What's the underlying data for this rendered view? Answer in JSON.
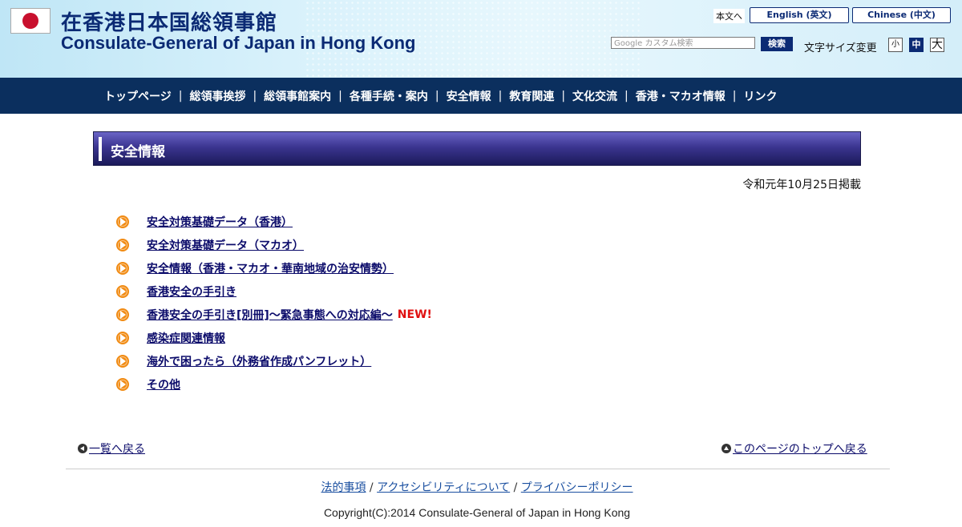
{
  "header": {
    "title_ja": "在香港日本国総領事館",
    "title_en": "Consulate-General of Japan in Hong Kong",
    "honbun": "本文へ",
    "lang_en": "English (英文)",
    "lang_zh": "Chinese (中文)",
    "search_placeholder": "Google カスタム検索",
    "search_button": "検索",
    "fontsize_label": "文字サイズ変更",
    "fontsize_small": "小",
    "fontsize_medium": "中",
    "fontsize_large": "大"
  },
  "nav": {
    "items": [
      "トップページ",
      "総領事挨拶",
      "総領事館案内",
      "各種手続・案内",
      "安全情報",
      "教育関連",
      "文化交流",
      "香港・マカオ情報",
      "リンク"
    ],
    "separator": "|"
  },
  "content": {
    "section_title": "安全情報",
    "date": "令和元年10月25日掲載",
    "links": [
      {
        "label": "安全対策基礎データ（香港）"
      },
      {
        "label": "安全対策基礎データ（マカオ）"
      },
      {
        "label": "安全情報（香港・マカオ・華南地域の治安情勢）"
      },
      {
        "label": "香港安全の手引き"
      },
      {
        "label": "香港安全の手引き[別冊]〜緊急事態への対応編〜",
        "badge": "NEW!"
      },
      {
        "label": "感染症関連情報"
      },
      {
        "label": "海外で困ったら（外務省作成パンフレット）"
      },
      {
        "label": "その他"
      }
    ],
    "back_to_list": "一覧へ戻る",
    "back_to_top": "このページのトップへ戻る"
  },
  "footer": {
    "legal": "法的事項",
    "accessibility": "アクセシビリティについて",
    "privacy": "プライバシーポリシー",
    "separator": " / ",
    "copyright": "Copyright(C):2014 Consulate-General of Japan in Hong Kong"
  },
  "colors": {
    "navy": "#0b2f5e",
    "link": "#0b0b6a",
    "new_badge": "#e01010",
    "bullet": "#f18b13"
  }
}
